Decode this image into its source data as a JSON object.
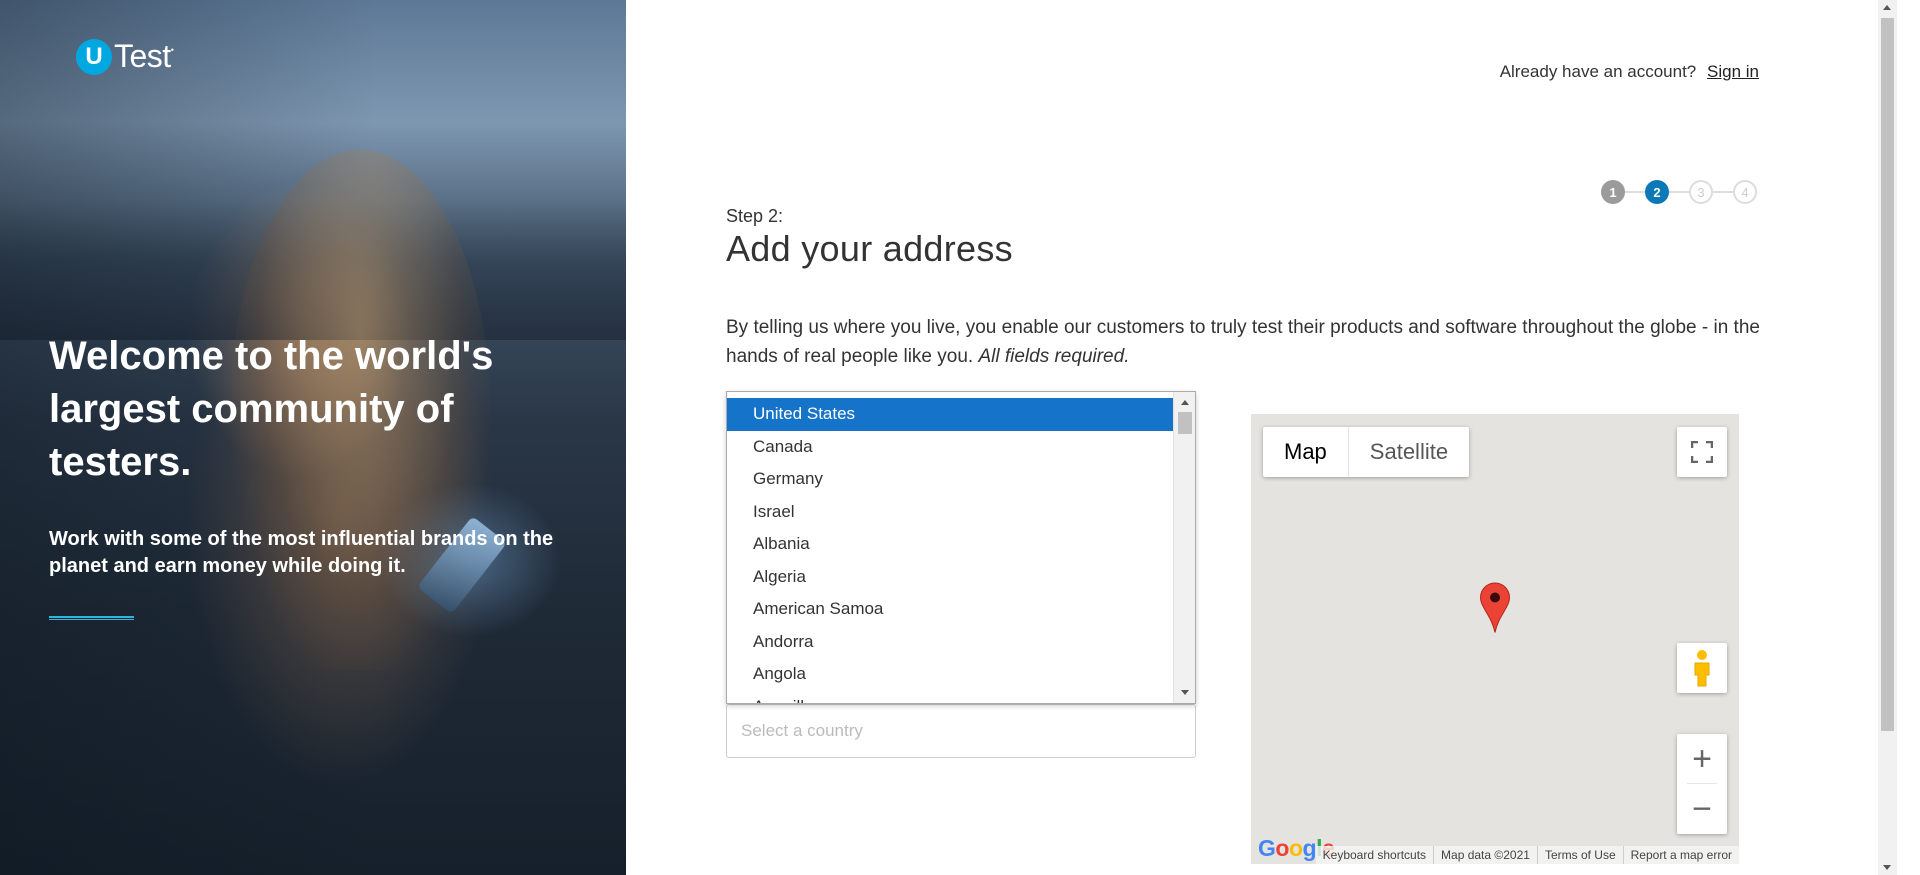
{
  "brand": {
    "logo_letter": "U",
    "logo_text": "Test",
    "logo_mark": "•"
  },
  "hero": {
    "title": "Welcome to the world's largest community of testers.",
    "subtitle": "Work with some of the most influential brands on the planet and earn money while doing it."
  },
  "header": {
    "account_prompt": "Already have an account?",
    "signin_label": "Sign in"
  },
  "steps": {
    "items": [
      "1",
      "2",
      "3",
      "4"
    ],
    "current": 2
  },
  "main": {
    "step_label": "Step 2:",
    "title": "Add your address",
    "description": "By telling us where you live, you enable our customers to truly test their products and software throughout the globe - in the hands of real people like you.",
    "description_note": "All fields required."
  },
  "country_dropdown": {
    "options": [
      "United States",
      "Canada",
      "Germany",
      "Israel",
      "Albania",
      "Algeria",
      "American Samoa",
      "Andorra",
      "Angola",
      "Anguilla"
    ],
    "highlighted": "United States"
  },
  "country_input": {
    "placeholder": "Select a country",
    "value": ""
  },
  "map": {
    "type_map": "Map",
    "type_satellite": "Satellite",
    "zoom_in": "+",
    "zoom_out": "−",
    "keyboard_shortcuts": "Keyboard shortcuts",
    "map_data": "Map data ©2021",
    "terms": "Terms of Use",
    "report": "Report a map error",
    "google_logo": [
      "G",
      "o",
      "o",
      "g",
      "l",
      "e"
    ]
  },
  "colors": {
    "accent": "#0c79b7",
    "brand": "#00a8e1",
    "selected": "#1573c9",
    "pin": "#ea4335"
  }
}
